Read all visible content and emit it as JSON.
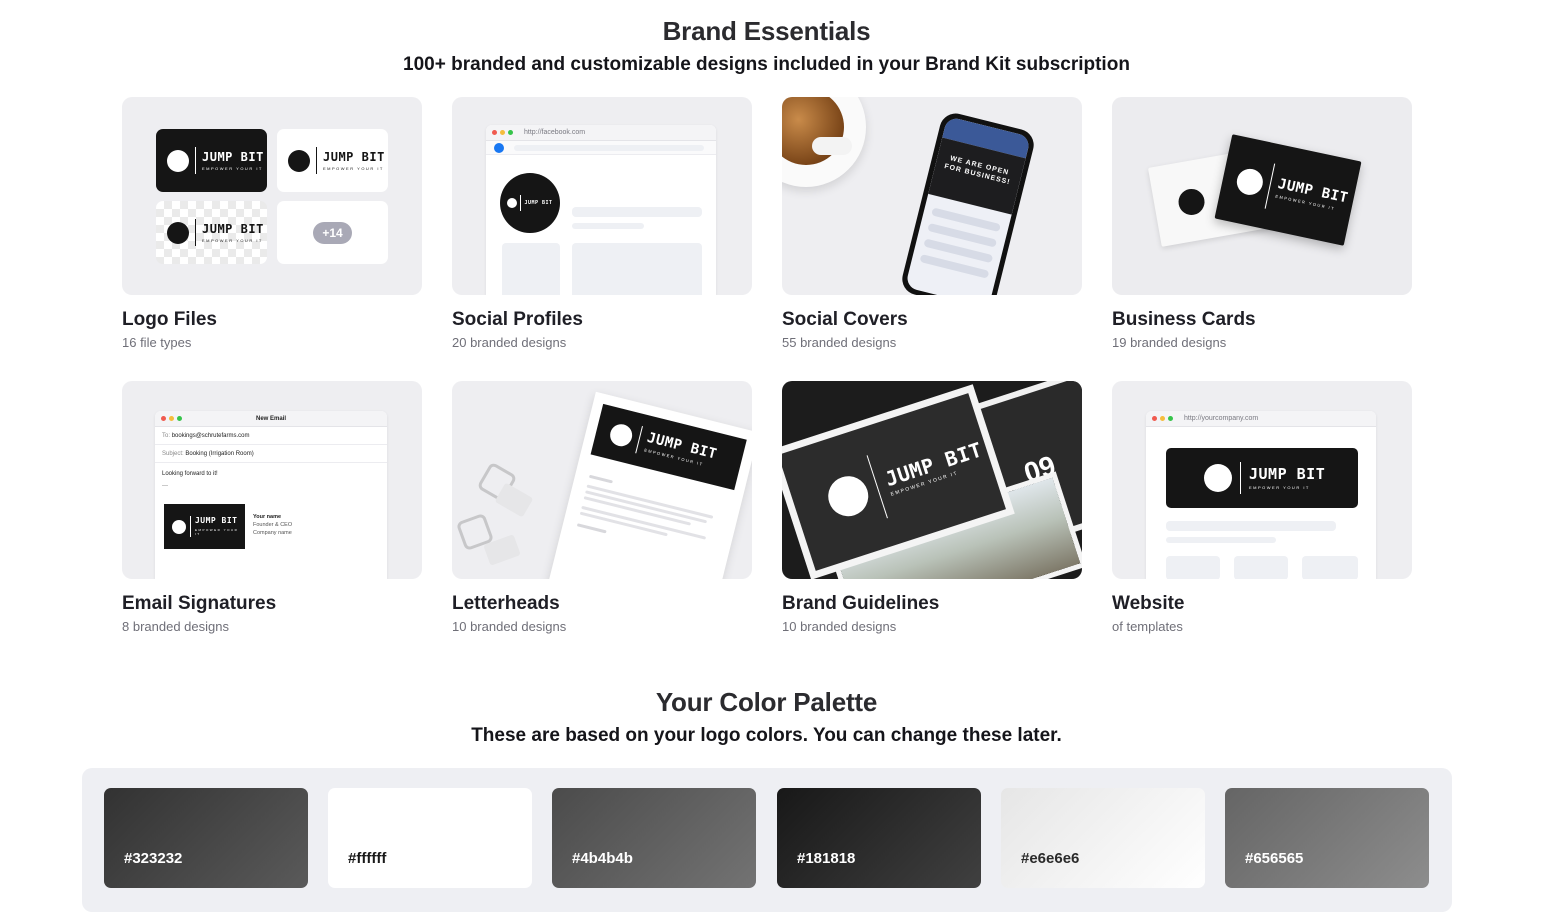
{
  "header": {
    "title": "Brand Essentials",
    "subtitle": "100+ branded and customizable designs included in your Brand Kit subscription"
  },
  "brand": {
    "name": "JUMP BIT",
    "tagline": "EMPOWER YOUR IT",
    "more_badge": "+14"
  },
  "cards": [
    {
      "title": "Logo Files",
      "subtitle": "16 file types"
    },
    {
      "title": "Social Profiles",
      "subtitle": "20 branded designs"
    },
    {
      "title": "Social Covers",
      "subtitle": "55 branded designs"
    },
    {
      "title": "Business Cards",
      "subtitle": "19 branded designs"
    },
    {
      "title": "Email Signatures",
      "subtitle": "8 branded designs"
    },
    {
      "title": "Letterheads",
      "subtitle": "10 branded designs"
    },
    {
      "title": "Brand Guidelines",
      "subtitle": "10 branded designs"
    },
    {
      "title": "Website",
      "subtitle": "of templates"
    }
  ],
  "mocks": {
    "facebook_url": "http://facebook.com",
    "cover_text_1": "WE ARE OPEN",
    "cover_text_2": "FOR BUSINESS!",
    "email_window_title": "New Email",
    "email_to_label": "To:",
    "email_to": "bookings@schrutefarms.com",
    "email_subject_label": "Subject:",
    "email_subject": "Booking (Irrigation Room)",
    "email_body": "Looking forward to it!",
    "email_sig_dash": "—",
    "sig_name": "Your name",
    "sig_role": "Founder & CEO",
    "sig_company": "Company name",
    "guideline_page_no": "09",
    "website_url": "http://yourcompany.com"
  },
  "palette_section": {
    "title": "Your Color Palette",
    "subtitle": "These are based on your logo colors. You can change these later."
  },
  "palette": [
    {
      "hex": "#323232",
      "text_color": "#ffffff"
    },
    {
      "hex": "#ffffff",
      "text_color": "#1a1a1a"
    },
    {
      "hex": "#4b4b4b",
      "text_color": "#ffffff"
    },
    {
      "hex": "#181818",
      "text_color": "#ffffff"
    },
    {
      "hex": "#e6e6e6",
      "text_color": "#2a2a2a"
    },
    {
      "hex": "#656565",
      "text_color": "#ffffff"
    }
  ]
}
